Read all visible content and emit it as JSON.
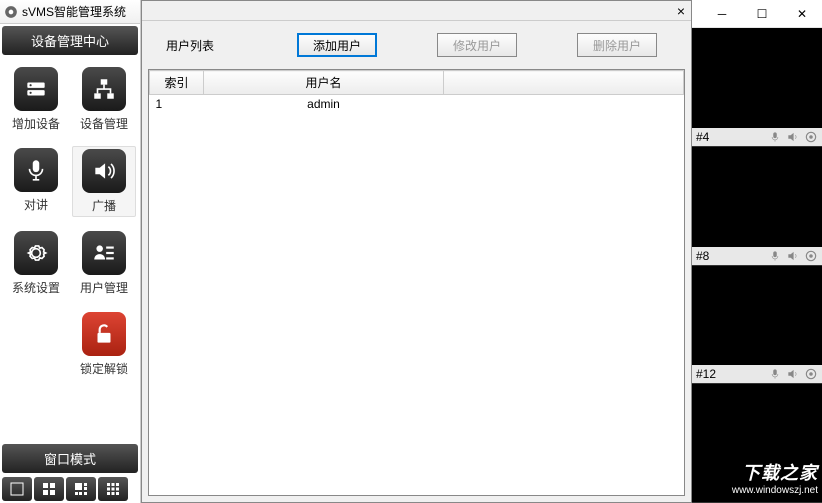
{
  "app_title": "sVMS智能管理系统",
  "left": {
    "header": "设备管理中心",
    "tools": [
      {
        "label": "增加设备",
        "name": "add-device"
      },
      {
        "label": "设备管理",
        "name": "device-manage"
      },
      {
        "label": "对讲",
        "name": "intercom"
      },
      {
        "label": "广播",
        "name": "broadcast"
      },
      {
        "label": "系统设置",
        "name": "system-settings"
      },
      {
        "label": "用户管理",
        "name": "user-manage"
      },
      {
        "label": "锁定解锁",
        "name": "lock-unlock"
      }
    ],
    "win_mode": "窗口模式"
  },
  "dialog": {
    "list_label": "用户列表",
    "buttons": {
      "add": "添加用户",
      "edit": "修改用户",
      "del": "删除用户"
    },
    "columns": [
      "索引",
      "用户名",
      ""
    ],
    "rows": [
      {
        "index": "1",
        "username": "admin"
      }
    ]
  },
  "cams": [
    "#4",
    "#8",
    "#12"
  ],
  "watermark": {
    "title": "下载之家",
    "url": "www.windowszj.net"
  }
}
